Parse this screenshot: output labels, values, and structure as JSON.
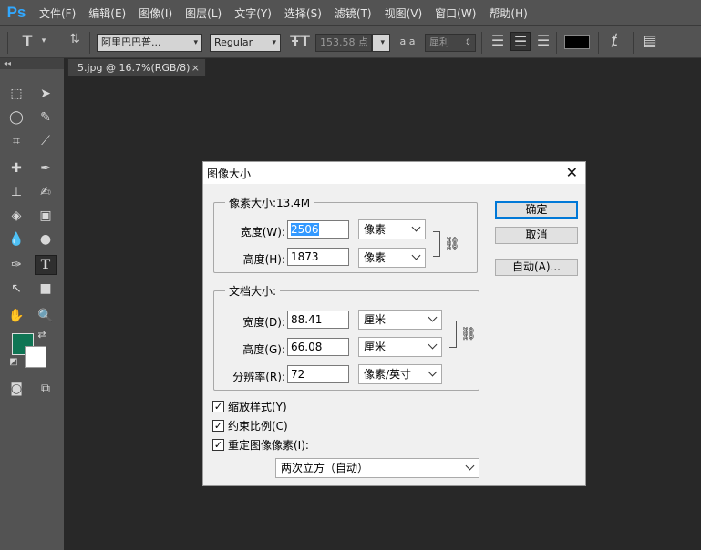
{
  "app": {
    "logo": "Ps"
  },
  "menu": [
    "文件(F)",
    "编辑(E)",
    "图像(I)",
    "图层(L)",
    "文字(Y)",
    "选择(S)",
    "滤镜(T)",
    "视图(V)",
    "窗口(W)",
    "帮助(H)"
  ],
  "options": {
    "tool_glyph": "T",
    "font_family": "阿里巴巴普...",
    "font_style": "Regular",
    "font_size": "153.58 点",
    "aa_label": "a a",
    "aa_mode": "犀利",
    "text_color": "#000000"
  },
  "toolpanel": {
    "collapse": "◂◂",
    "foreground": "#0f7554",
    "background": "#ffffff"
  },
  "document_tab": {
    "title": "5.jpg @ 16.7%(RGB/8)",
    "close": "×"
  },
  "dialog": {
    "title": "图像大小",
    "close": "✕",
    "pixel_dimensions": {
      "legend": "像素大小:13.4M",
      "width_label": "宽度(W):",
      "width_value": "2506",
      "width_unit": "像素",
      "height_label": "高度(H):",
      "height_value": "1873",
      "height_unit": "像素"
    },
    "document_size": {
      "legend": "文档大小:",
      "width_label": "宽度(D):",
      "width_value": "88.41",
      "width_unit": "厘米",
      "height_label": "高度(G):",
      "height_value": "66.08",
      "height_unit": "厘米",
      "resolution_label": "分辨率(R):",
      "resolution_value": "72",
      "resolution_unit": "像素/英寸"
    },
    "checkboxes": {
      "scale_styles": "缩放样式(Y)",
      "constrain": "约束比例(C)",
      "resample": "重定图像像素(I):"
    },
    "check_mark": "✓",
    "resample_method": "两次立方（自动）",
    "buttons": {
      "ok": "确定",
      "cancel": "取消",
      "auto": "自动(A)..."
    }
  }
}
